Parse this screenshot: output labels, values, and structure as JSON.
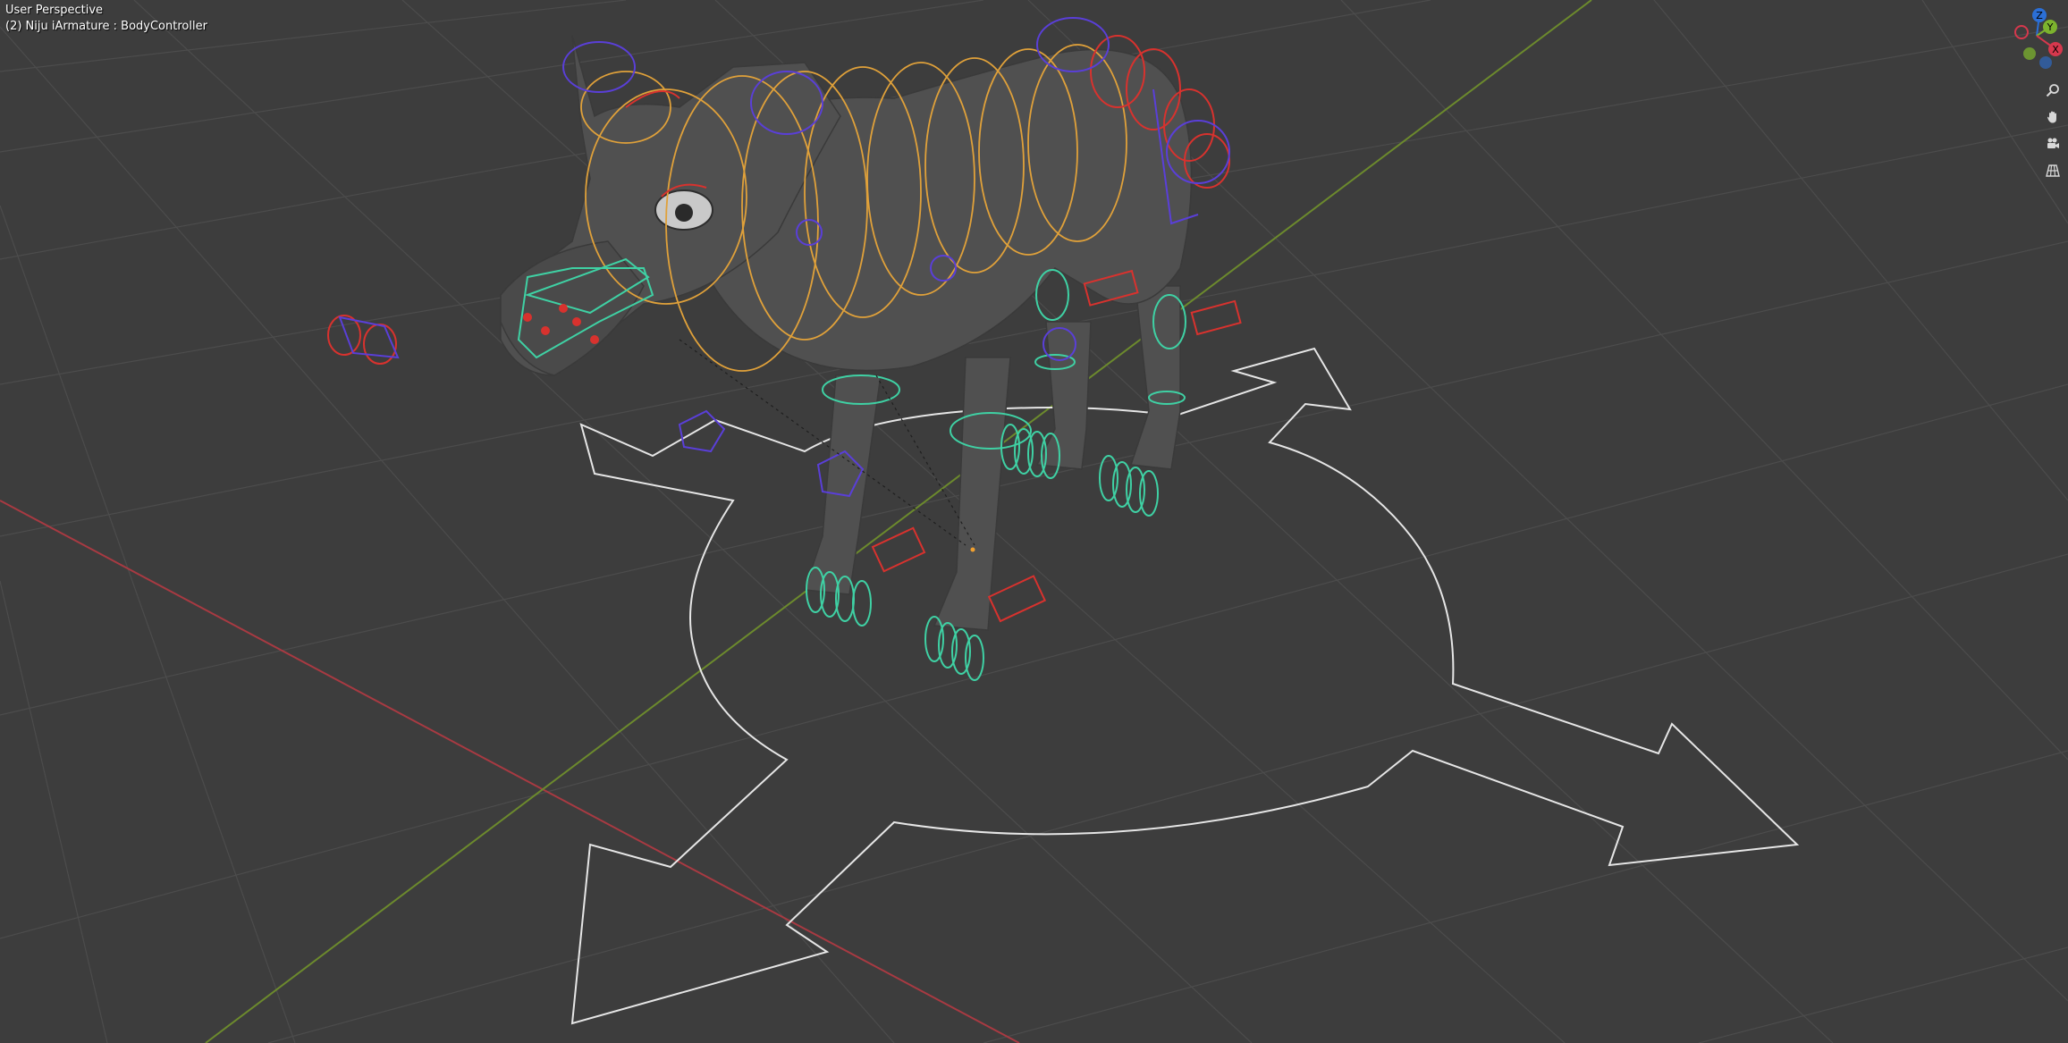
{
  "viewport": {
    "view_name": "User Perspective",
    "object_info": "(2) Niju iArmature : BodyController"
  },
  "gizmo": {
    "axes": [
      {
        "label": "Z",
        "color": "#2b6fd6"
      },
      {
        "label": "Y",
        "color": "#7cb32e"
      },
      {
        "label": "X",
        "color": "#d6384d"
      }
    ]
  },
  "nav_buttons": [
    {
      "name": "zoom-icon",
      "glyph": "🔍"
    },
    {
      "name": "pan-hand-icon",
      "glyph": "✋"
    },
    {
      "name": "camera-icon",
      "glyph": "🎥"
    },
    {
      "name": "grid-ortho-icon",
      "glyph": "▦"
    }
  ],
  "colors": {
    "background": "#3d3d3d",
    "grid": "#505050",
    "x_axis": "#a83a42",
    "y_axis": "#6c8a2d",
    "bone_orange": "#e0a13a",
    "bone_teal": "#3fd1a4",
    "bone_red": "#d8322e",
    "bone_blue": "#5a3fd8",
    "controller_white": "#e6e6e6"
  }
}
